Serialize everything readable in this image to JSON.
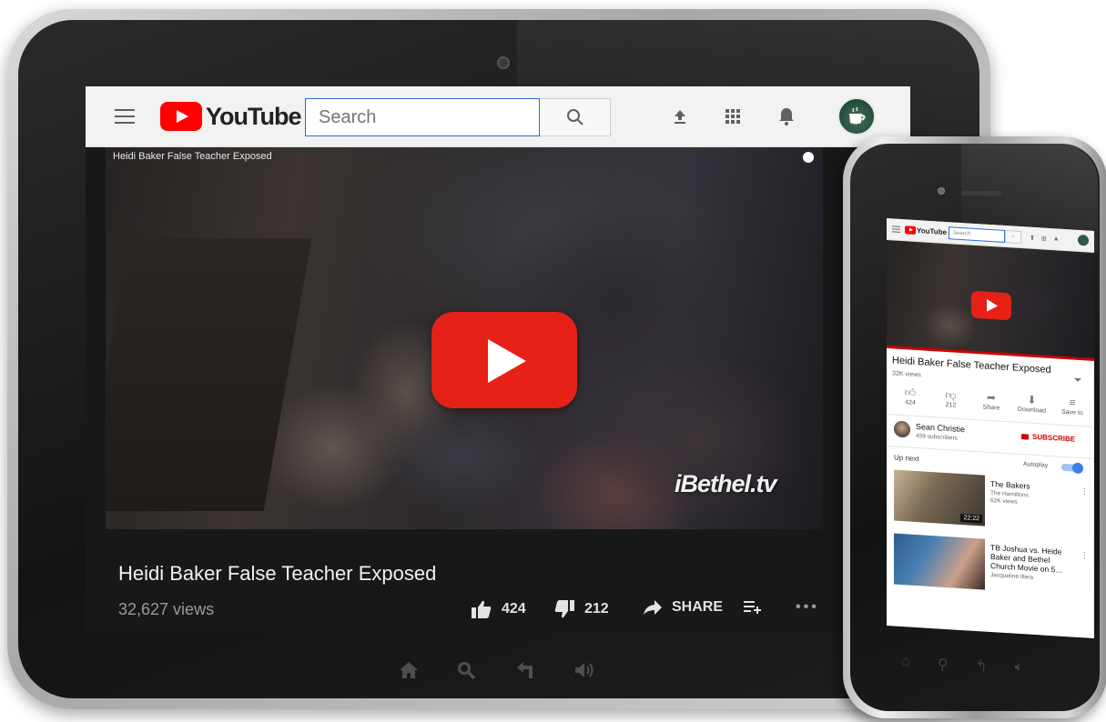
{
  "tablet": {
    "header": {
      "logo_text": "YouTube",
      "search_placeholder": "Search"
    },
    "video": {
      "overlay_title": "Heidi Baker False Teacher Exposed",
      "watermark": "iBethel.tv",
      "title": "Heidi Baker False Teacher Exposed",
      "views": "32,627 views",
      "likes": "424",
      "dislikes": "212",
      "share_label": "SHARE"
    }
  },
  "phone": {
    "header": {
      "logo_text": "YouTube",
      "search_placeholder": "Search"
    },
    "video": {
      "title": "Heidi Baker False Teacher Exposed",
      "views": "32K views",
      "likes": "424",
      "dislikes": "212",
      "share_label": "Share",
      "download_label": "Download",
      "save_label": "Save to"
    },
    "channel": {
      "name": "Sean Christie",
      "subscribers": "459 subscribers",
      "subscribe_label": "SUBSCRIBE"
    },
    "up_next": {
      "heading": "Up next",
      "autoplay_label": "Autoplay",
      "autoplay_on": true,
      "items": [
        {
          "title": "The Bakers",
          "channel": "The Hamiltons",
          "views": "62K views",
          "duration": "22:22"
        },
        {
          "title": "TB Joshua vs. Heide Baker and Bethel Church Movie on 5...",
          "channel": "Jacqueline Illera"
        }
      ]
    }
  },
  "colors": {
    "youtube_red": "#ff0000",
    "play_red": "#e62117",
    "search_border": "#2d6ad9",
    "subscribe_red": "#cc0000",
    "toggle_blue": "#3b82e8"
  }
}
